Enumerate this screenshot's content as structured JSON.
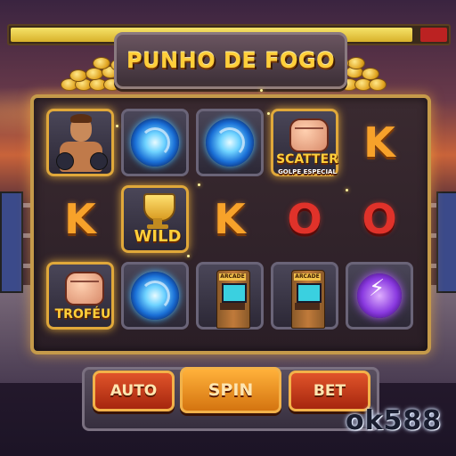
{
  "game": {
    "title": "PUNHO DE FOGO",
    "health_fill": 0.92
  },
  "reels": {
    "symbols": {
      "wild_label": "WILD",
      "scatter_label": "SCATTER",
      "scatter_sub": "GOLPE ESPECIAL",
      "trophy_label": "TROFÉU",
      "arcade_label": "ARCADE",
      "k": "K",
      "o": "O"
    }
  },
  "controls": {
    "auto_label": "AUTO",
    "spin_label": "SPIN",
    "bet_label": "BET"
  },
  "brand": {
    "text": "ok588"
  },
  "icons": {
    "fighter": "fighter-portrait-icon",
    "portal": "blue-vortex-icon",
    "fist": "fist-icon",
    "trophy": "trophy-cup-icon",
    "arcade": "arcade-cabinet-icon",
    "lightning": "lightning-orb-icon"
  },
  "colors": {
    "accent_gold": "#ffcf3a",
    "frame_gold": "#c59a4a",
    "letter_k": "#f7a22a",
    "letter_o": "#e0322a"
  }
}
